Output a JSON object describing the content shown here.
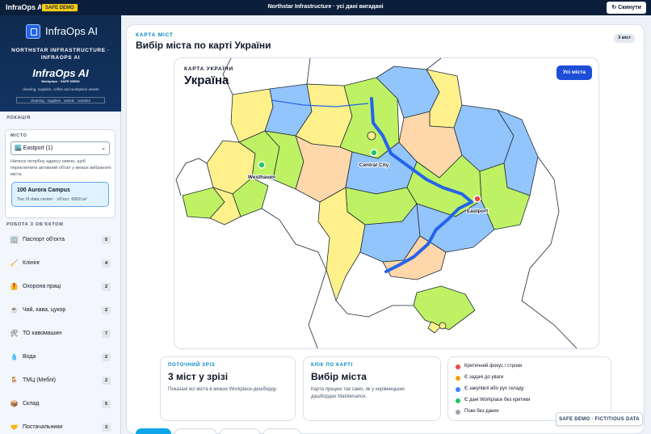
{
  "topbar": {
    "brand": "InfraOps AI",
    "safe_badge": "SAFE DEMO",
    "title": "Northstar Infrastructure · усі дані вигадані",
    "reset_label": "↻ Скинути"
  },
  "sidebar": {
    "logo_title": "InfraOps AI",
    "org_line1": "NORTHSTAR INFRASTRUCTURE ·",
    "org_line2": "INFRAOPS AI",
    "big_logo": "InfraOps AI",
    "big_logo_sub": "Workplace · SAFE DEMO",
    "tagline": "cleaning, supplies, coffee and workplace assets",
    "tags": "cleaning · supplies · assets · vendors",
    "location_section": "ЛОКАЦІЯ",
    "city_label": "МІСТО",
    "city_value": "🏙️ Eastport (1)",
    "hint": "Натисні потрібну адресу нижче, щоб переключити активний об'єкт у межах вибраного міста.",
    "campus_name": "100 Aurora Campus",
    "campus_details": "Tier III data center · об'єкт: 6800 м²",
    "work_section": "РОБОТА З ОБ'ЄКТОМ",
    "work_items": [
      {
        "label": "Паспорт об'єкта",
        "count": "5",
        "icon": "🏢"
      },
      {
        "label": "Клінінг",
        "count": "4",
        "icon": "🧹"
      },
      {
        "label": "Охорона праці",
        "count": "2",
        "icon": "🦺"
      },
      {
        "label": "Чай, кава, цукор",
        "count": "2",
        "icon": "☕"
      },
      {
        "label": "ТО кавомашин",
        "count": "7",
        "icon": "🛠"
      },
      {
        "label": "Вода",
        "count": "2",
        "icon": "💧"
      },
      {
        "label": "ТМЦ (Меблі)",
        "count": "2",
        "icon": "🪑"
      },
      {
        "label": "Склад",
        "count": "5",
        "icon": "📦"
      },
      {
        "label": "Постачальники",
        "count": "3",
        "icon": "🤝"
      }
    ]
  },
  "main": {
    "kicker": "КАРТА МІСТ",
    "title": "Вибір міста по карті України",
    "count_badge": "3 міст",
    "map_kicker": "КАРТА УКРАЇНИ",
    "map_title": "Україна",
    "all_cities_button": "Усі міста",
    "cities": [
      {
        "name": "Westhaven",
        "status": "green"
      },
      {
        "name": "Central City",
        "status": "green"
      },
      {
        "name": "Eastport",
        "status": "red"
      }
    ]
  },
  "cards": [
    {
      "kicker": "ПОТОЧНИЙ ЗРІЗ",
      "value": "3 міст у зрізі",
      "desc": "Показані всі міста в межах Workplace-дешборду."
    },
    {
      "kicker": "КЛІК ПО КАРТІ",
      "value": "Вибір міста",
      "desc": "Карта працює так само, як у керівницьких дашбордах Maintenance."
    }
  ],
  "legend": [
    {
      "label": "Критичний фокус / строки",
      "color": "#ef4444"
    },
    {
      "label": "Є задачі до уваги",
      "color": "#f59e0b"
    },
    {
      "label": "Є закупівлі або рух складу",
      "color": "#3b82f6"
    },
    {
      "label": "Є дані Workplace без критики",
      "color": "#22c55e"
    },
    {
      "label": "Поки без даних",
      "color": "#9ca3af"
    }
  ],
  "footer_badge": "SAFE DEMO · FICTITIOUS DATA",
  "colors": {
    "navy": "#0b1f3a",
    "accent": "#0284c7",
    "primary": "#1d4ed8"
  }
}
